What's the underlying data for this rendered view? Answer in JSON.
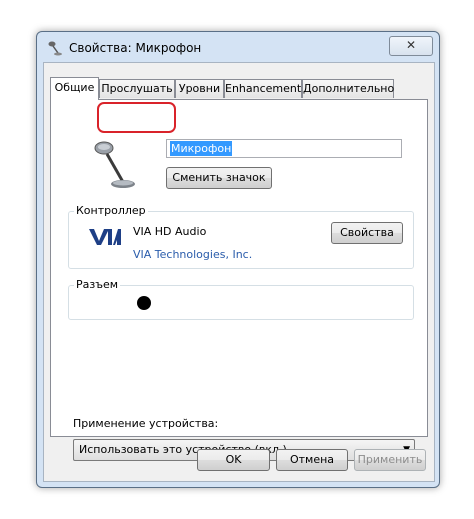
{
  "window": {
    "title": "Свойства: Микрофон",
    "close_label": "✕"
  },
  "tabs": [
    {
      "label": "Общие",
      "active": true
    },
    {
      "label": "Прослушать",
      "active": false
    },
    {
      "label": "Уровни",
      "active": false
    },
    {
      "label": "Enhancements",
      "active": false
    },
    {
      "label": "Дополнительно",
      "active": false
    }
  ],
  "general": {
    "device_name": "Микрофон",
    "change_icon_label": "Сменить значок"
  },
  "controller": {
    "heading": "Контроллер",
    "device": "VIA HD Audio",
    "vendor": "VIA Technologies, Inc.",
    "properties_label": "Свойства",
    "vendor_color": "#2a5cab"
  },
  "jack": {
    "heading": "Разъем"
  },
  "usage": {
    "label": "Применение устройства:",
    "selected": "Использовать это устройство (вкл.)"
  },
  "buttons": {
    "ok": "OK",
    "cancel": "Отмена",
    "apply": "Применить"
  }
}
